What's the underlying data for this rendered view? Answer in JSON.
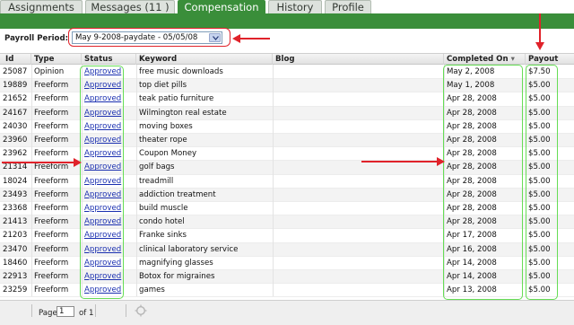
{
  "tabs": [
    {
      "label": "Assignments",
      "active": false
    },
    {
      "label": "Messages (11 )",
      "active": false
    },
    {
      "label": "Compensation",
      "active": true
    },
    {
      "label": "History",
      "active": false
    },
    {
      "label": "Profile",
      "active": false
    }
  ],
  "payroll": {
    "label": "Payroll Period:",
    "selected": "May 9-2008-paydate - 05/05/08"
  },
  "table": {
    "headers": {
      "id": "Id",
      "type": "Type",
      "status": "Status",
      "keyword": "Keyword",
      "blog": "Blog",
      "completed": "Completed On",
      "payout": "Payout"
    },
    "sort_indicator": "▾",
    "rows": [
      {
        "id": "25087",
        "type": "Opinion",
        "status": "Approved",
        "keyword": "free music downloads",
        "blog": "",
        "completed": "May 2, 2008",
        "payout": "$7.50"
      },
      {
        "id": "19889",
        "type": "Freeform",
        "status": "Approved",
        "keyword": "top diet pills",
        "blog": "",
        "completed": "May 1, 2008",
        "payout": "$5.00"
      },
      {
        "id": "21652",
        "type": "Freeform",
        "status": "Approved",
        "keyword": "teak patio furniture",
        "blog": "",
        "completed": "Apr 28, 2008",
        "payout": "$5.00"
      },
      {
        "id": "24167",
        "type": "Freeform",
        "status": "Approved",
        "keyword": "Wilmington real estate",
        "blog": "",
        "completed": "Apr 28, 2008",
        "payout": "$5.00"
      },
      {
        "id": "24030",
        "type": "Freeform",
        "status": "Approved",
        "keyword": "moving boxes",
        "blog": "",
        "completed": "Apr 28, 2008",
        "payout": "$5.00"
      },
      {
        "id": "23960",
        "type": "Freeform",
        "status": "Approved",
        "keyword": "theater rope",
        "blog": "",
        "completed": "Apr 28, 2008",
        "payout": "$5.00"
      },
      {
        "id": "23962",
        "type": "Freeform",
        "status": "Approved",
        "keyword": "Coupon Money",
        "blog": "",
        "completed": "Apr 28, 2008",
        "payout": "$5.00"
      },
      {
        "id": "21314",
        "type": "Freeform",
        "status": "Approved",
        "keyword": "golf bags",
        "blog": "",
        "completed": "Apr 28, 2008",
        "payout": "$5.00"
      },
      {
        "id": "18024",
        "type": "Freeform",
        "status": "Approved",
        "keyword": "treadmill",
        "blog": "",
        "completed": "Apr 28, 2008",
        "payout": "$5.00"
      },
      {
        "id": "23493",
        "type": "Freeform",
        "status": "Approved",
        "keyword": "addiction treatment",
        "blog": "",
        "completed": "Apr 28, 2008",
        "payout": "$5.00"
      },
      {
        "id": "23368",
        "type": "Freeform",
        "status": "Approved",
        "keyword": "build muscle",
        "blog": "",
        "completed": "Apr 28, 2008",
        "payout": "$5.00"
      },
      {
        "id": "21413",
        "type": "Freeform",
        "status": "Approved",
        "keyword": "condo hotel",
        "blog": "",
        "completed": "Apr 28, 2008",
        "payout": "$5.00"
      },
      {
        "id": "21203",
        "type": "Freeform",
        "status": "Approved",
        "keyword": "Franke sinks",
        "blog": "",
        "completed": "Apr 17, 2008",
        "payout": "$5.00"
      },
      {
        "id": "23470",
        "type": "Freeform",
        "status": "Approved",
        "keyword": "clinical laboratory service",
        "blog": "",
        "completed": "Apr 16, 2008",
        "payout": "$5.00"
      },
      {
        "id": "18460",
        "type": "Freeform",
        "status": "Approved",
        "keyword": "magnifying glasses",
        "blog": "",
        "completed": "Apr 14, 2008",
        "payout": "$5.00"
      },
      {
        "id": "22913",
        "type": "Freeform",
        "status": "Approved",
        "keyword": "Botox for migraines",
        "blog": "",
        "completed": "Apr 14, 2008",
        "payout": "$5.00"
      },
      {
        "id": "23259",
        "type": "Freeform",
        "status": "Approved",
        "keyword": "games",
        "blog": "",
        "completed": "Apr 13, 2008",
        "payout": "$5.00"
      }
    ]
  },
  "pager": {
    "page_label": "Page",
    "page_value": "1",
    "of_label": "of 1"
  },
  "colors": {
    "tab_active": "#3a8e3a",
    "link": "#1a2fb0",
    "annotation_red": "#e0222a",
    "annotation_green": "#66dd55"
  },
  "icons": [
    "dropdown-arrow-icon",
    "refresh-icon",
    "red-arrow-annotation"
  ]
}
